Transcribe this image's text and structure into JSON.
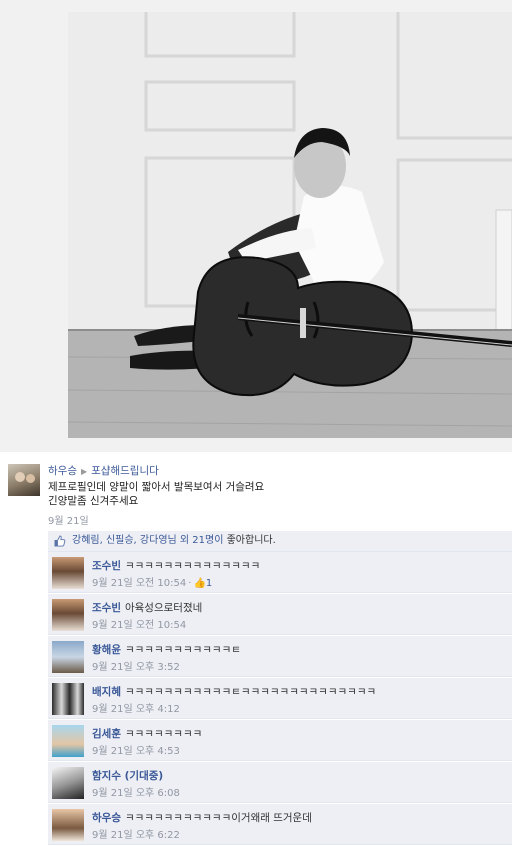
{
  "post": {
    "author": "하우승",
    "target": "포샵해드립니다",
    "text_lines": [
      "제프로필인데 양말이 짧아서 발목보여서 거슬려요",
      "긴양말좀 신겨주세요"
    ],
    "date": "9월 21일"
  },
  "likes": {
    "names": "강혜림, 신필승, 강다영님",
    "others": "외 21명이",
    "suffix": " 좋아합니다."
  },
  "comments": [
    {
      "name": "조수빈",
      "text": "ㅋㅋㅋㅋㅋㅋㅋㅋㅋㅋㅋㅋㅋㅋ",
      "time": "9월 21일 오전 10:54",
      "likes": "1"
    },
    {
      "name": "조수빈",
      "text": "아육성으로터졌네",
      "time": "9월 21일 오전 10:54"
    },
    {
      "name": "황해윤",
      "text": "ㅋㅋㅋㅋㅋㅋㅋㅋㅋㅋㅋㅌ",
      "time": "9월 21일 오후 3:52"
    },
    {
      "name": "배지혜",
      "text": "ㅋㅋㅋㅋㅋㅋㅋㅋㅋㅋㅋㅌㅋㅋㅋㅋㅋㅋㅋㅋㅋㅋㅋㅋㅋㅋ",
      "time": "9월 21일 오후 4:12"
    },
    {
      "name": "김세훈",
      "text": "ㅋㅋㅋㅋㅋㅋㅋㅋ",
      "time": "9월 21일 오후 4:53"
    },
    {
      "name": "함지수 (기대중)",
      "text": "",
      "time": "9월 21일 오후 6:08"
    },
    {
      "name": "하우승",
      "text": "ㅋㅋㅋㅋㅋㅋㅋㅋㅋㅋㅋ이거왜래 뜨거운데",
      "time": "9월 21일 오후 6:22"
    }
  ],
  "colors": {
    "link": "#3b5998",
    "meta": "#9197a3",
    "comment_bg": "#edeff4"
  }
}
